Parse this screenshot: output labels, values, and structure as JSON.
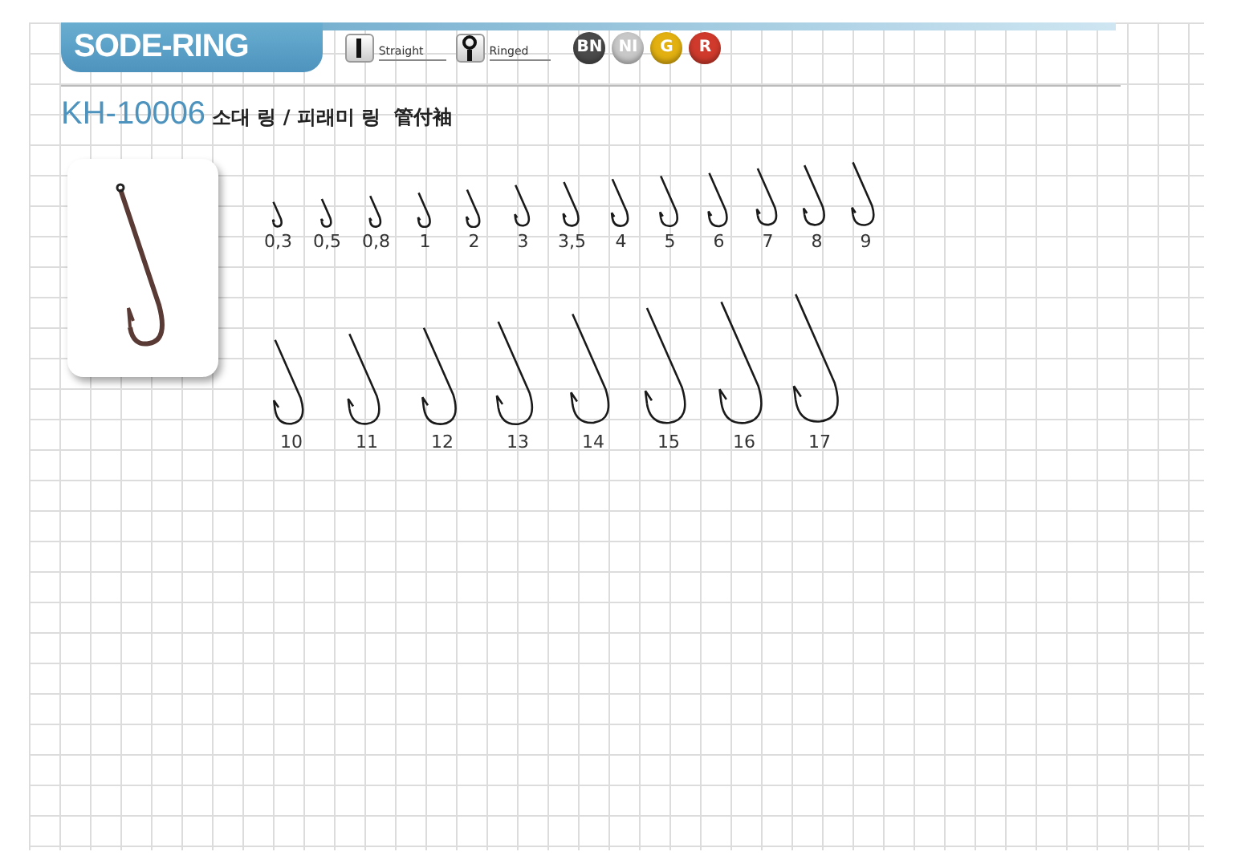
{
  "header": {
    "title": "SODE-RING",
    "eye_types": [
      {
        "kind": "straight",
        "label": "Straight"
      },
      {
        "kind": "ringed",
        "label": "Ringed"
      }
    ],
    "finishes": [
      {
        "label": "BN",
        "color": "#4a4a4a"
      },
      {
        "label": "NI",
        "color": "#c8c8c8"
      },
      {
        "label": "G",
        "color": "#e2b010"
      },
      {
        "label": "R",
        "color": "#cf3a2c"
      }
    ]
  },
  "product": {
    "code": "KH-10006",
    "name": "소대 링 / 피래미 링  管付袖"
  },
  "hook_rows": [
    {
      "sizes": [
        "0,3",
        "0,5",
        "0,8",
        "1",
        "2",
        "3",
        "3,5",
        "4",
        "5",
        "6",
        "7",
        "8",
        "9"
      ]
    },
    {
      "sizes": [
        "10",
        "11",
        "12",
        "13",
        "14",
        "15",
        "16",
        "17"
      ]
    }
  ]
}
